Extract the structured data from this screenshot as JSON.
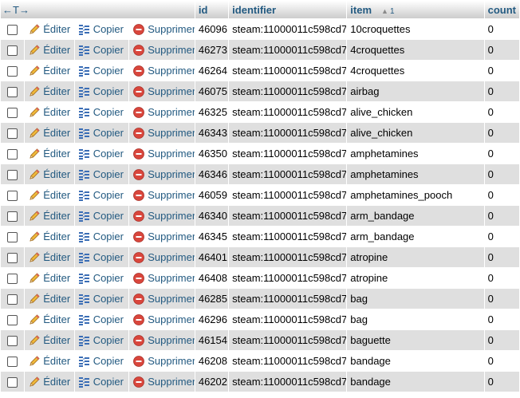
{
  "header": {
    "arrows": "←T→",
    "columns": [
      {
        "label": "id"
      },
      {
        "label": "identifier"
      },
      {
        "label": "item",
        "sort_order": "1"
      },
      {
        "label": "count"
      }
    ]
  },
  "actions": {
    "edit": "Éditer",
    "copy": "Copier",
    "delete": "Supprimer"
  },
  "rows": [
    {
      "id": "46096",
      "identifier": "steam:11000011c598cd7",
      "item": "10croquettes",
      "count": "0"
    },
    {
      "id": "46273",
      "identifier": "steam:11000011c598cd7",
      "item": "4croquettes",
      "count": "0"
    },
    {
      "id": "46264",
      "identifier": "steam:11000011c598cd7",
      "item": "4croquettes",
      "count": "0"
    },
    {
      "id": "46075",
      "identifier": "steam:11000011c598cd7",
      "item": "airbag",
      "count": "0"
    },
    {
      "id": "46325",
      "identifier": "steam:11000011c598cd7",
      "item": "alive_chicken",
      "count": "0"
    },
    {
      "id": "46343",
      "identifier": "steam:11000011c598cd7",
      "item": "alive_chicken",
      "count": "0"
    },
    {
      "id": "46350",
      "identifier": "steam:11000011c598cd7",
      "item": "amphetamines",
      "count": "0"
    },
    {
      "id": "46346",
      "identifier": "steam:11000011c598cd7",
      "item": "amphetamines",
      "count": "0"
    },
    {
      "id": "46059",
      "identifier": "steam:11000011c598cd7",
      "item": "amphetamines_pooch",
      "count": "0"
    },
    {
      "id": "46340",
      "identifier": "steam:11000011c598cd7",
      "item": "arm_bandage",
      "count": "0"
    },
    {
      "id": "46345",
      "identifier": "steam:11000011c598cd7",
      "item": "arm_bandage",
      "count": "0"
    },
    {
      "id": "46401",
      "identifier": "steam:11000011c598cd7",
      "item": "atropine",
      "count": "0"
    },
    {
      "id": "46408",
      "identifier": "steam:11000011c598cd7",
      "item": "atropine",
      "count": "0"
    },
    {
      "id": "46285",
      "identifier": "steam:11000011c598cd7",
      "item": "bag",
      "count": "0"
    },
    {
      "id": "46296",
      "identifier": "steam:11000011c598cd7",
      "item": "bag",
      "count": "0"
    },
    {
      "id": "46154",
      "identifier": "steam:11000011c598cd7",
      "item": "baguette",
      "count": "0"
    },
    {
      "id": "46208",
      "identifier": "steam:11000011c598cd7",
      "item": "bandage",
      "count": "0"
    },
    {
      "id": "46202",
      "identifier": "steam:11000011c598cd7",
      "item": "bandage",
      "count": "0"
    }
  ],
  "colors": {
    "link": "#235a81",
    "row_alt": "#dfdfdf",
    "delete_icon": "#d9463c"
  },
  "icons": {
    "edit": "pencil-icon",
    "copy": "copy-icon",
    "delete": "delete-icon"
  }
}
